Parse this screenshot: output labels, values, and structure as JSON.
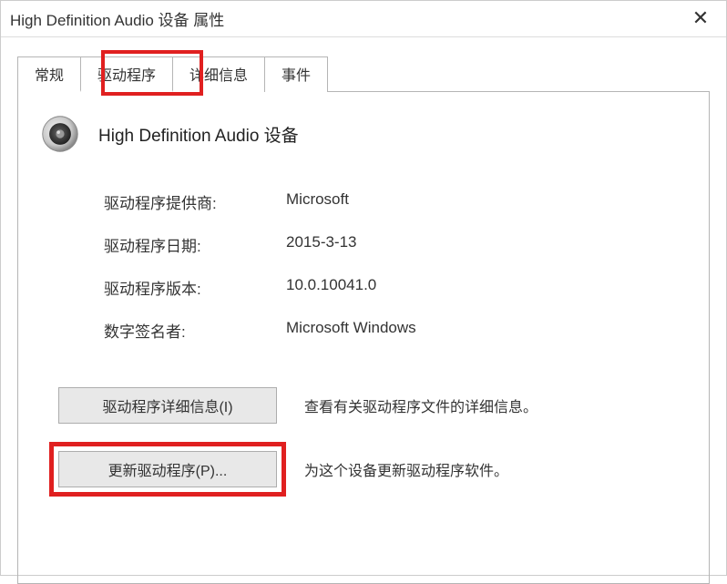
{
  "window": {
    "title": "High Definition Audio 设备 属性",
    "close_symbol": "✕"
  },
  "tabs": [
    {
      "label": "常规"
    },
    {
      "label": "驱动程序"
    },
    {
      "label": "详细信息"
    },
    {
      "label": "事件"
    }
  ],
  "active_tab_index": 1,
  "device": {
    "name": "High Definition Audio 设备"
  },
  "driver_info": {
    "provider_label": "驱动程序提供商:",
    "provider_value": "Microsoft",
    "date_label": "驱动程序日期:",
    "date_value": "2015-3-13",
    "version_label": "驱动程序版本:",
    "version_value": "10.0.10041.0",
    "signer_label": "数字签名者:",
    "signer_value": "Microsoft Windows"
  },
  "actions": {
    "details_btn": "驱动程序详细信息(I)",
    "details_desc": "查看有关驱动程序文件的详细信息。",
    "update_btn": "更新驱动程序(P)...",
    "update_desc": "为这个设备更新驱动程序软件。"
  }
}
